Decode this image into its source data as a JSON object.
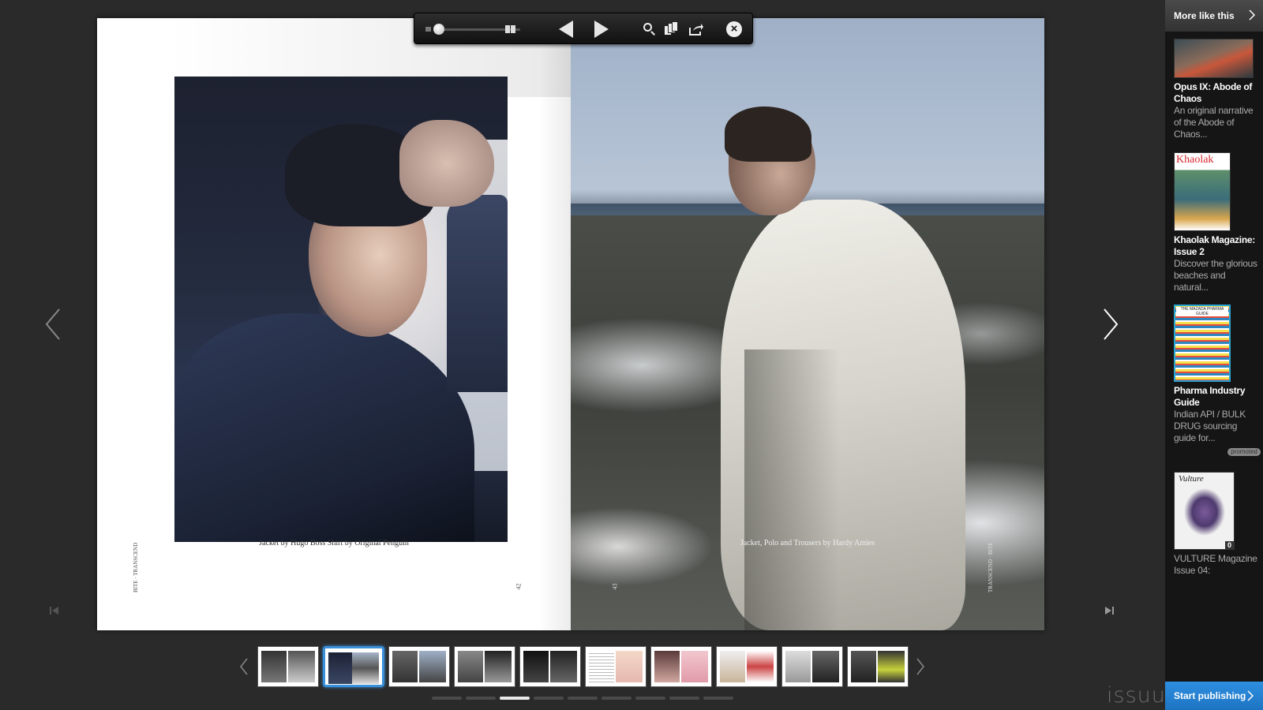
{
  "toolbar": {
    "zoom_icon": "zoom-slider",
    "icons": [
      "grid-view-icon",
      "prev-page-icon",
      "next-page-icon",
      "search-icon",
      "pages-icon",
      "share-icon",
      "close-icon"
    ]
  },
  "spread": {
    "left": {
      "caption": "Jacket by Hugo Boss   Shirt by Original Penguin",
      "spine": "BITE · TRANSCEND",
      "page_number": "42"
    },
    "right": {
      "caption": "Jacket, Polo and Trousers by Hardy Amies",
      "spine": "TRANSCEND · BITE",
      "page_number": "43"
    }
  },
  "thumbnails": {
    "count": 10,
    "active_index": 1
  },
  "pager": {
    "count": 9,
    "active_index": 2
  },
  "brand": {
    "logo": "issuu"
  },
  "sidebar": {
    "header": "More like this",
    "items": [
      {
        "title": "Opus IX: Abode of Chaos",
        "desc": "An original narrative of the Abode of Chaos...",
        "badge": ""
      },
      {
        "title": "Khaolak Magazine: Issue 2",
        "desc": "Discover the glorious beaches and natural...",
        "badge": "",
        "cover_text": "Khaolak"
      },
      {
        "title": "Pharma Industry Guide",
        "desc": "Indian API / BULK DRUG sourcing guide for...",
        "badge": "promoted",
        "cover_text": "THE MAZADA PHARMA GUIDE"
      },
      {
        "title": "",
        "desc": "VULTURE Magazine Issue 04:",
        "badge": "0",
        "cover_text": "Vulture"
      }
    ],
    "cta": "Start publishing"
  },
  "colors": {
    "accent": "#2f8ee0",
    "active_thumb": "#3a8fd9"
  }
}
